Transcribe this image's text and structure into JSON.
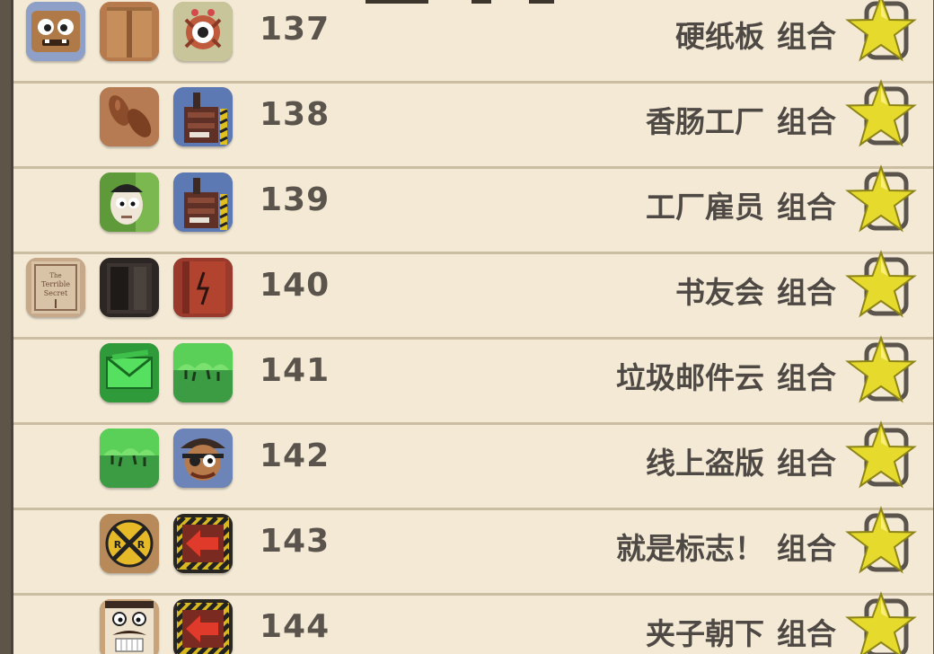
{
  "achievements": [
    {
      "number": "137",
      "name": "硬纸板",
      "suffix": "组合",
      "icons": [
        "cardboard-face-icon",
        "cardboard-box-icon",
        "spider-eye-icon"
      ]
    },
    {
      "number": "138",
      "name": "香肠工厂",
      "suffix": "组合",
      "icons": [
        "sausages-icon",
        "factory-icon"
      ]
    },
    {
      "number": "139",
      "name": "工厂雇员",
      "suffix": "组合",
      "icons": [
        "worker-face-icon",
        "factory-icon"
      ]
    },
    {
      "number": "140",
      "name": "书友会",
      "suffix": "组合",
      "icons": [
        "terrible-secret-book-icon",
        "dark-book-icon",
        "red-book-icon"
      ]
    },
    {
      "number": "141",
      "name": "垃圾邮件云",
      "suffix": "组合",
      "icons": [
        "green-envelope-icon",
        "green-cloud-icon"
      ]
    },
    {
      "number": "142",
      "name": "线上盗版",
      "suffix": "组合",
      "icons": [
        "green-cloud-icon",
        "pirate-icon"
      ]
    },
    {
      "number": "143",
      "name": "就是标志！",
      "suffix": "组合",
      "icons": [
        "railroad-sign-icon",
        "arrow-sign-icon"
      ]
    },
    {
      "number": "144",
      "name": "夹子朝下",
      "suffix": "组合",
      "icons": [
        "mustache-face-icon",
        "arrow-sign-icon"
      ]
    }
  ],
  "book_cover_text": "The Terrible Secret",
  "railroad_sign_letters": [
    "R",
    "R"
  ],
  "colors": {
    "paper": "#f3e9d5",
    "rule_line": "#cabda2",
    "text": "#4e4944",
    "star_fill": "#e6da2c",
    "star_outline": "#3e3a34"
  }
}
